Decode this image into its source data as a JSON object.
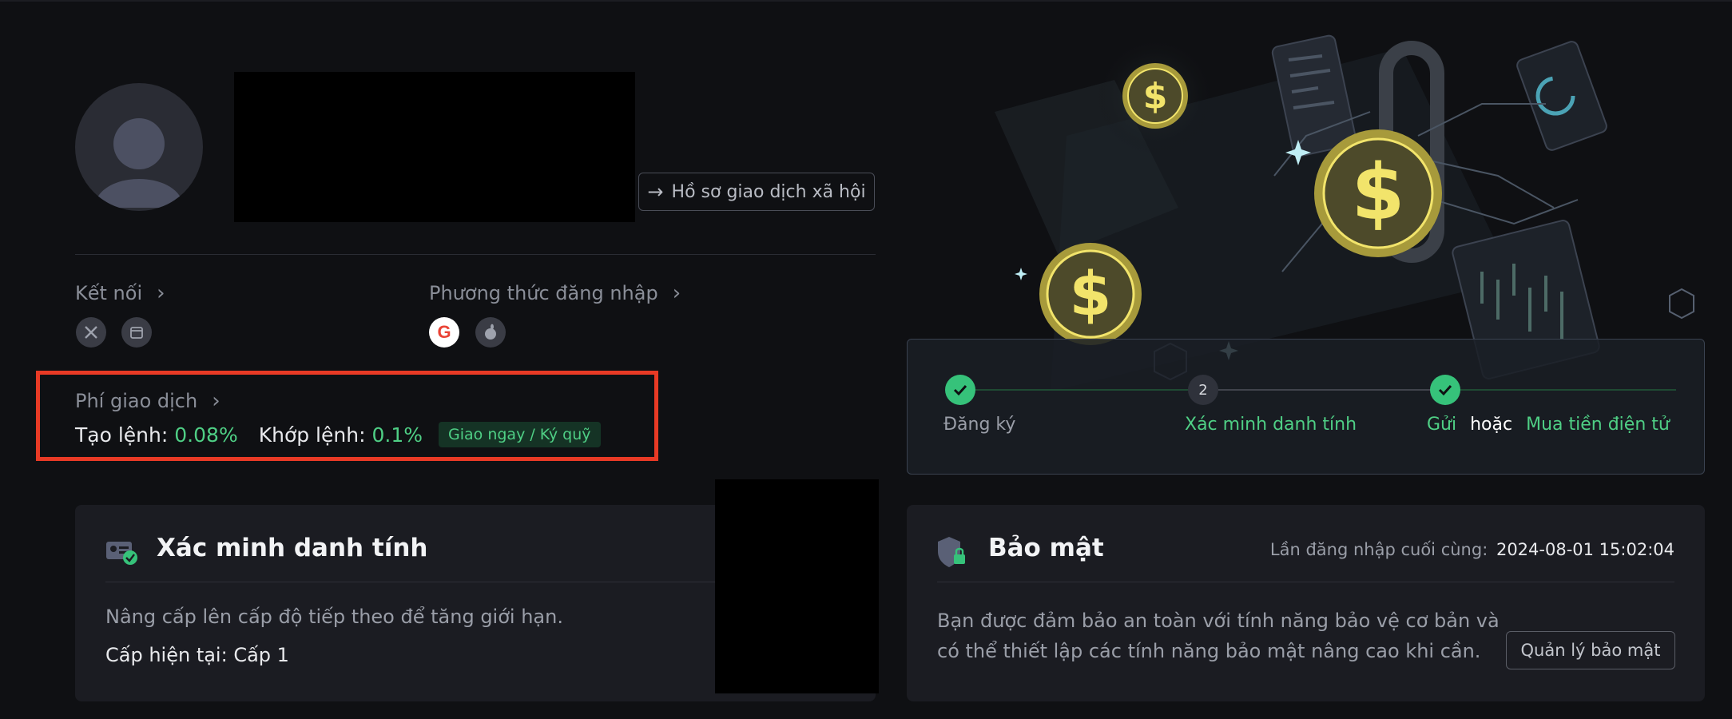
{
  "profile": {
    "social_profile_button": "Hồ sơ giao dịch xã hội"
  },
  "connections": {
    "title": "Kết nối",
    "icons": [
      "x-icon",
      "calendar-icon"
    ]
  },
  "login_methods": {
    "title": "Phương thức đăng nhập",
    "icons": [
      "google-icon",
      "apple-icon"
    ]
  },
  "fees": {
    "title": "Phí giao dịch",
    "maker_label": "Tạo lệnh:",
    "maker_value": "0.08%",
    "taker_label": "Khớp lệnh:",
    "taker_value": "0.1%",
    "badge": "Giao ngay / Ký quỹ"
  },
  "steps": [
    {
      "label": "Đăng ký",
      "state": "done"
    },
    {
      "number": "2",
      "label": "Xác minh danh tính",
      "state": "current"
    },
    {
      "label_a": "Gửi",
      "label_or": "hoặc",
      "label_b": "Mua tiền điện tử",
      "state": "done"
    }
  ],
  "identity_card": {
    "title": "Xác minh danh tính",
    "description": "Nâng cấp lên cấp độ tiếp theo để tăng giới hạn.",
    "current_level": "Cấp hiện tại: Cấp 1"
  },
  "security_card": {
    "title": "Bảo mật",
    "last_login_label": "Lần đăng nhập cuối cùng:",
    "last_login_value": "2024-08-01 15:02:04",
    "description_line1": "Bạn được đảm bảo an toàn với tính năng bảo vệ cơ bản và",
    "description_line2": "có thể thiết lập các tính năng bảo mật nâng cao khi cần.",
    "manage_button": "Quản lý bảo mật"
  },
  "colors": {
    "accent_green": "#4fcf85",
    "highlight_red": "#e83a25",
    "coin_gold": "#f2e46b"
  }
}
